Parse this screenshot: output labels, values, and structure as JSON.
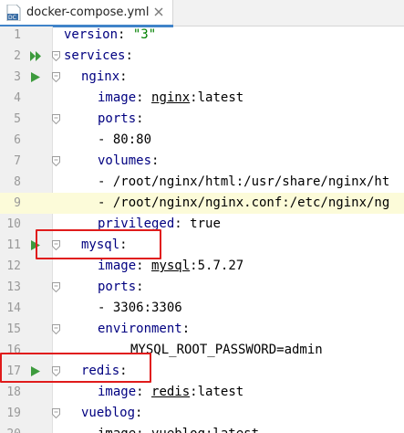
{
  "tab": {
    "filename": "docker-compose.yml",
    "icon": "yaml-file-icon",
    "accent": "#4083c9"
  },
  "lines": [
    {
      "num": "1",
      "parts": [
        {
          "t": "version",
          "c": "k"
        },
        {
          "t": ": "
        },
        {
          "t": "\"3\"",
          "c": "str"
        }
      ]
    },
    {
      "num": "2",
      "parts": [
        {
          "t": "services",
          "c": "k"
        },
        {
          "t": ":"
        }
      ]
    },
    {
      "num": "3",
      "parts": [
        {
          "t": "nginx",
          "c": "k"
        },
        {
          "t": ":"
        }
      ]
    },
    {
      "num": "4",
      "parts": [
        {
          "t": "image",
          "c": "k"
        },
        {
          "t": ": "
        },
        {
          "t": "nginx",
          "c": "u"
        },
        {
          "t": ":latest"
        }
      ]
    },
    {
      "num": "5",
      "parts": [
        {
          "t": "ports",
          "c": "k"
        },
        {
          "t": ":"
        }
      ]
    },
    {
      "num": "6",
      "parts": [
        {
          "t": "- 80:80"
        }
      ]
    },
    {
      "num": "7",
      "parts": [
        {
          "t": "volumes",
          "c": "k"
        },
        {
          "t": ":"
        }
      ]
    },
    {
      "num": "8",
      "parts": [
        {
          "t": "- /root/nginx/html:/usr/share/nginx/ht"
        }
      ]
    },
    {
      "num": "9",
      "parts": [
        {
          "t": "- /root/nginx/nginx.conf:/etc/nginx/ng"
        }
      ]
    },
    {
      "num": "10",
      "parts": [
        {
          "t": "privileged",
          "c": "k"
        },
        {
          "t": ": true"
        }
      ]
    },
    {
      "num": "11",
      "parts": [
        {
          "t": "mysql",
          "c": "k"
        },
        {
          "t": ":"
        }
      ]
    },
    {
      "num": "12",
      "parts": [
        {
          "t": "image",
          "c": "k"
        },
        {
          "t": ": "
        },
        {
          "t": "mysql",
          "c": "u"
        },
        {
          "t": ":5.7.27"
        }
      ]
    },
    {
      "num": "13",
      "parts": [
        {
          "t": "ports",
          "c": "k"
        },
        {
          "t": ":"
        }
      ]
    },
    {
      "num": "14",
      "parts": [
        {
          "t": "- 3306:3306"
        }
      ]
    },
    {
      "num": "15",
      "parts": [
        {
          "t": "environment",
          "c": "k"
        },
        {
          "t": ":"
        }
      ]
    },
    {
      "num": "16",
      "parts": [
        {
          "t": "MYSQL_ROOT_PASSWORD=admin"
        }
      ]
    },
    {
      "num": "17",
      "parts": [
        {
          "t": "redis",
          "c": "k"
        },
        {
          "t": ":"
        }
      ]
    },
    {
      "num": "18",
      "parts": [
        {
          "t": "image",
          "c": "k"
        },
        {
          "t": ": "
        },
        {
          "t": "redis",
          "c": "u"
        },
        {
          "t": ":latest"
        }
      ]
    },
    {
      "num": "19",
      "parts": [
        {
          "t": "vueblog",
          "c": "k"
        },
        {
          "t": ":"
        }
      ]
    },
    {
      "num": "20",
      "parts": [
        {
          "t": "image: vueblog:latest"
        }
      ]
    }
  ],
  "colors": {
    "keyword": "#000080",
    "string": "#008000",
    "current_line": "#fcfbd9",
    "highlight_box": "#e01b1b",
    "run_icon": "#3d9b3d"
  }
}
